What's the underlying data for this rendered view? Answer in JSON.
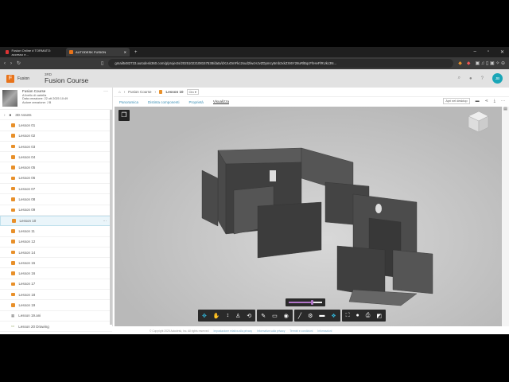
{
  "browser": {
    "tabs": [
      {
        "label": "Fusion Online # TORMATO: accesso e..."
      },
      {
        "label": "AUTODESK FUSION"
      }
    ],
    "url": "gmail5482733.autodesk360.com/g/projects/20251022108157538/data/dXJuOmFkc2sud2lwcHJvZDpmcy5mb2xkZXI6Y28uRlBqcFhHeFlRUkc3N..."
  },
  "header": {
    "logo": "Fusion",
    "project_type": "3RD",
    "project_title": "Fusion Course",
    "avatar": "JB"
  },
  "project": {
    "name": "Fusion Course",
    "level": "A livello di cartella",
    "created_label": "Data creazione:",
    "created": "22 ott 2025 10:49",
    "author_label": "Autore creazione:",
    "author": "J B"
  },
  "tree": {
    "folder": "3D Assets",
    "items": [
      "Lesson 01",
      "Lesson 02",
      "Lesson 03",
      "Lesson 04",
      "Lesson 05",
      "Lesson 06",
      "Lesson 07",
      "Lesson 08",
      "Lesson 09",
      "Lesson 10",
      "Lesson 11",
      "Lesson 12",
      "Lesson 14",
      "Lesson 15",
      "Lesson 16",
      "Lesson 17",
      "Lesson 18",
      "Lesson 19",
      "Lesson 19.ani",
      "Lesson 20 Drawing"
    ],
    "selected": "Lesson 10"
  },
  "breadcrumb": {
    "root": "Fusion Course",
    "current": "Lesson 10",
    "version": "Ctn"
  },
  "tabs": [
    "Panoramica",
    "Distinta componenti",
    "Proprietà",
    "Visualizza"
  ],
  "active_tab": "Visualizza",
  "open_desktop": "Apri nel desktop",
  "slider_value": 0.7,
  "footer": {
    "copyright": "© Copyright 2025 Autodesk, Inc. All rights reserved",
    "links": [
      "Impostazione relativa alla privacy",
      "Informativa sulla privacy",
      "Termini e condizioni",
      "Informazioni"
    ]
  },
  "colors": {
    "accent": "#31b3d6",
    "brand": "#e8731a",
    "avatar": "#1aa6b7"
  }
}
